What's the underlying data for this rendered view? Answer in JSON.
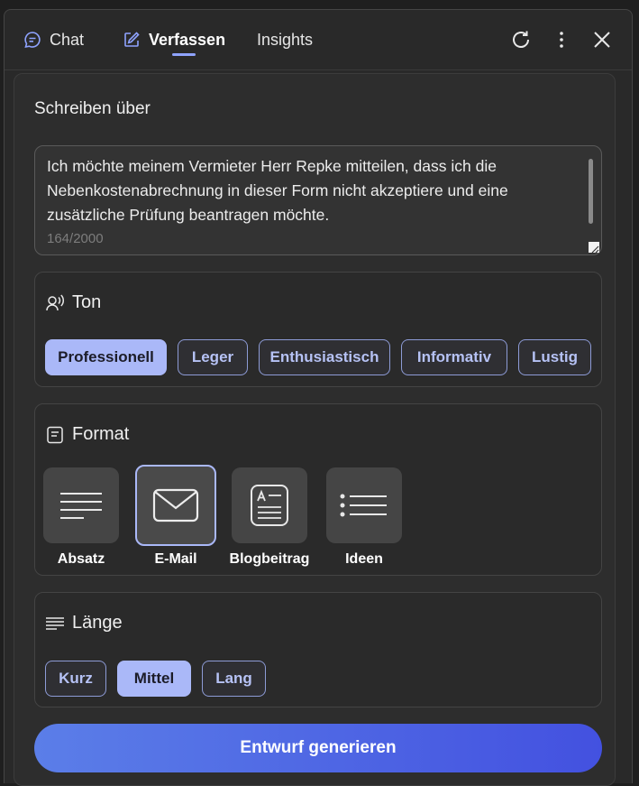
{
  "header": {
    "tabs": [
      {
        "label": "Chat",
        "icon": "chat-icon",
        "active": false
      },
      {
        "label": "Verfassen",
        "icon": "compose-icon",
        "active": true
      },
      {
        "label": "Insights",
        "icon": "",
        "active": false
      }
    ],
    "actions": [
      "refresh-icon",
      "more-options-icon",
      "close-icon"
    ]
  },
  "compose": {
    "label": "Schreiben über",
    "text": "Ich möchte meinem Vermieter Herr Repke mitteilen, dass ich die Nebenkostenabrechnung in dieser Form nicht akzeptiere und eine zusätzliche Prüfung beantragen möchte.",
    "counter": "164/2000"
  },
  "tone": {
    "title": "Ton",
    "options": [
      "Professionell",
      "Leger",
      "Enthusiastisch",
      "Informativ",
      "Lustig"
    ],
    "selected": "Professionell"
  },
  "format": {
    "title": "Format",
    "options": [
      "Absatz",
      "E-Mail",
      "Blogbeitrag",
      "Ideen"
    ],
    "selected": "E-Mail"
  },
  "length": {
    "title": "Länge",
    "options": [
      "Kurz",
      "Mittel",
      "Lang"
    ],
    "selected": "Mittel"
  },
  "generate_label": "Entwurf generieren",
  "colors": {
    "accent": "#aab8f8",
    "button_start": "#5b7ee8",
    "button_end": "#4351e0"
  }
}
